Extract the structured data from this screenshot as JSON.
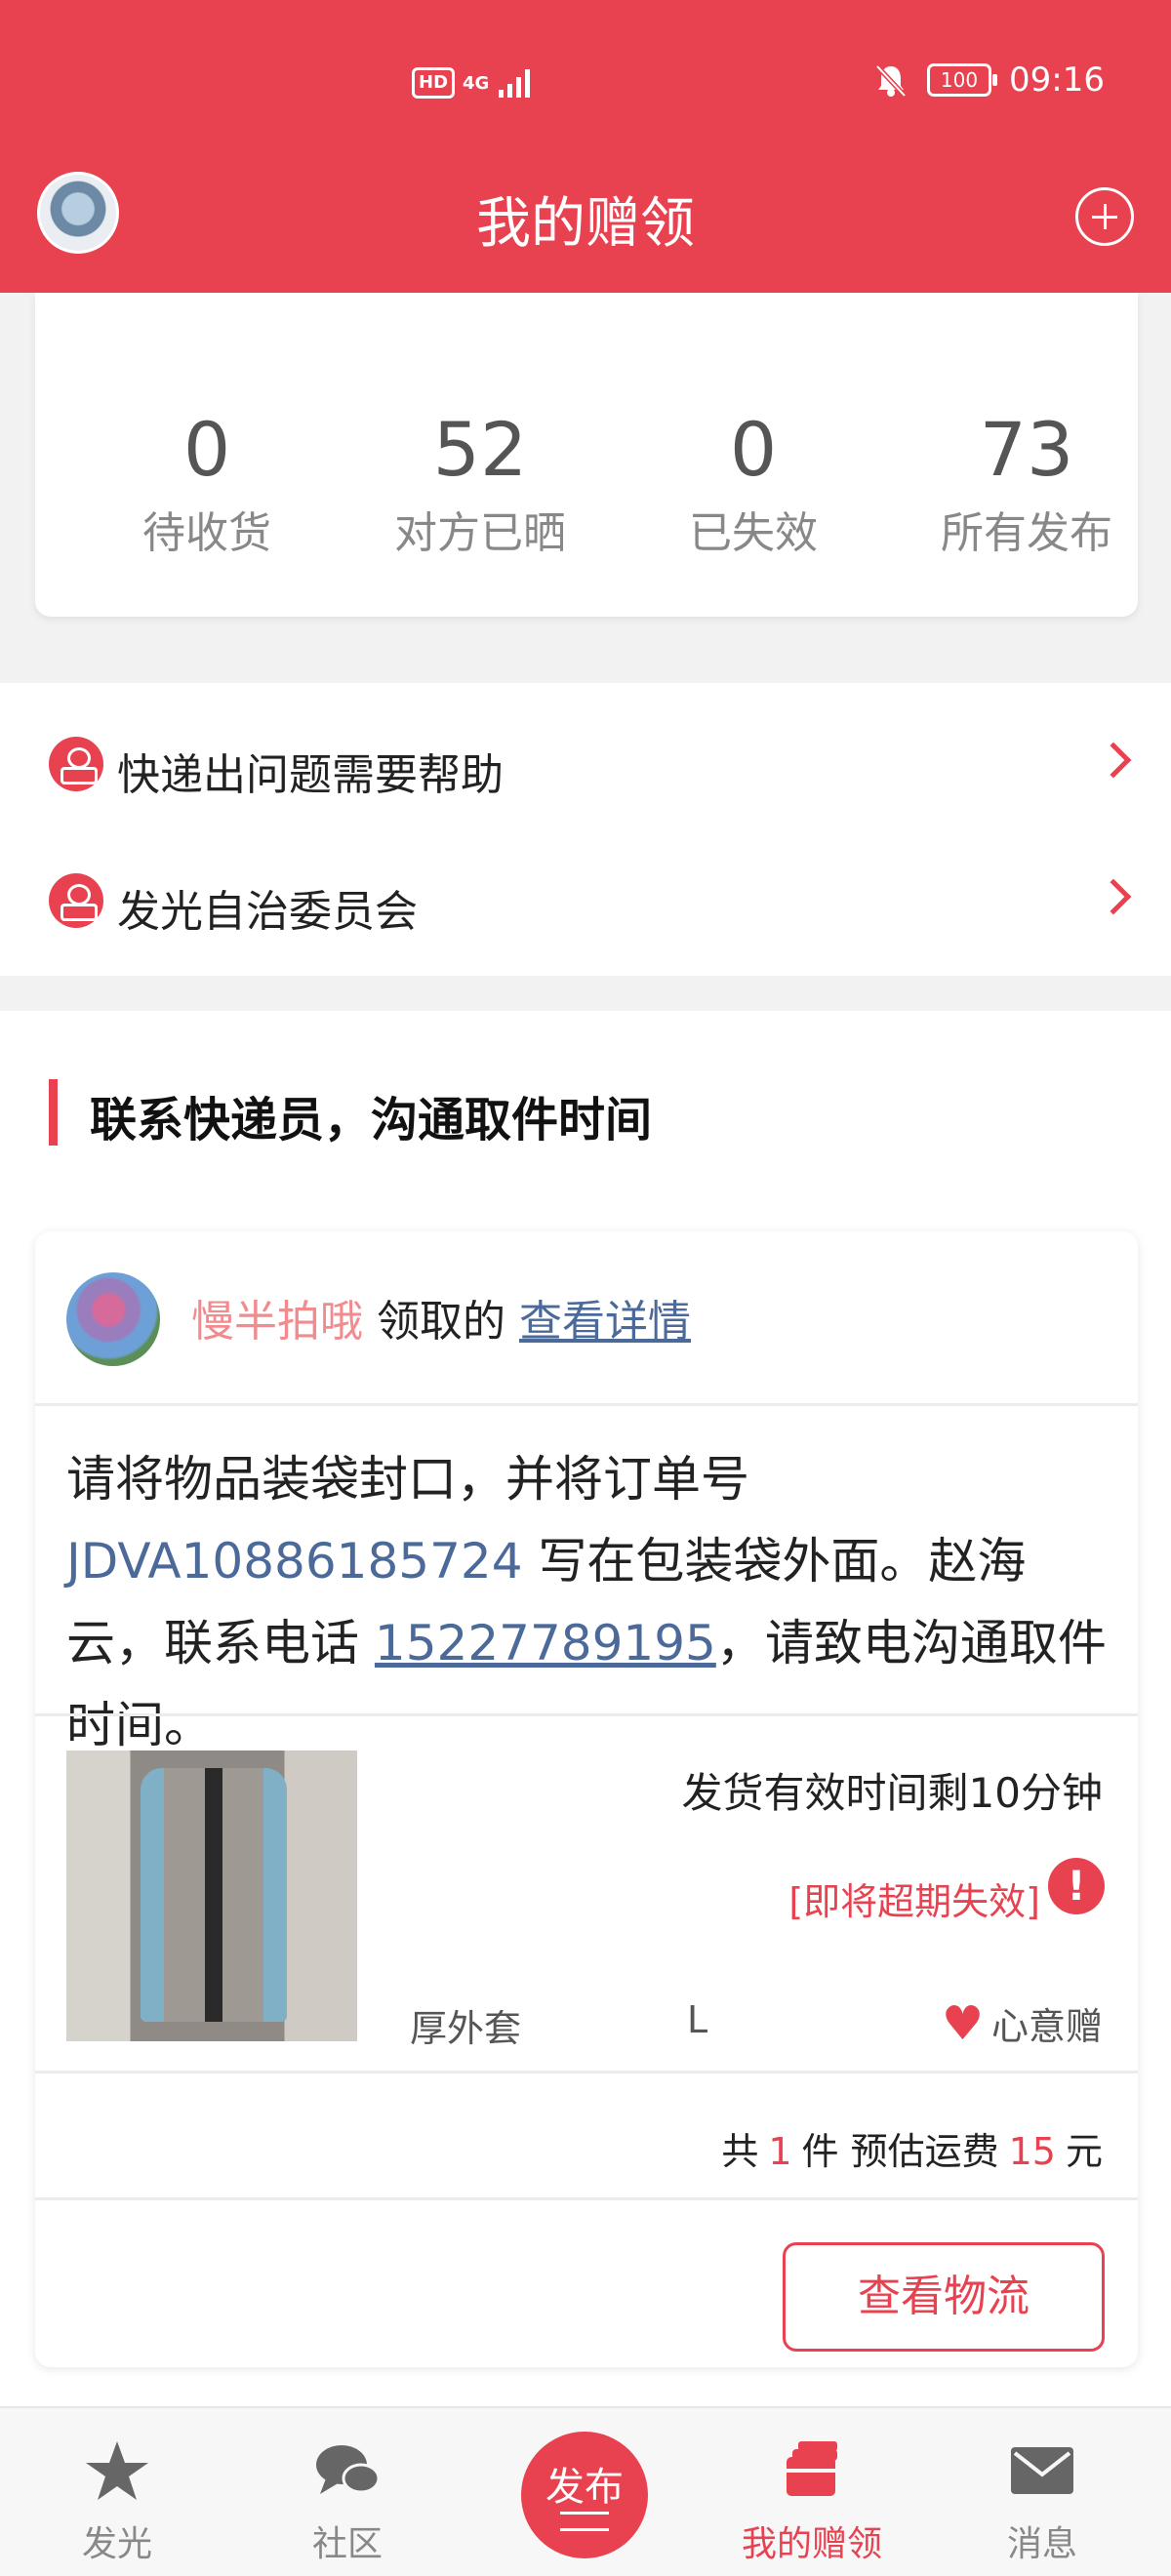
{
  "statusbar": {
    "network": "4G",
    "hd": "HD",
    "battery": "100",
    "time": "09:16"
  },
  "header": {
    "title": "我的赠领"
  },
  "stats": [
    {
      "value": "0",
      "label": "待收货"
    },
    {
      "value": "52",
      "label": "对方已晒"
    },
    {
      "value": "0",
      "label": "已失效"
    },
    {
      "value": "73",
      "label": "所有发布"
    }
  ],
  "help": [
    {
      "label": "快递出问题需要帮助"
    },
    {
      "label": "发光自治委员会"
    }
  ],
  "section": {
    "title": "联系快递员，沟通取件时间"
  },
  "order": {
    "user_name": "慢半拍哦",
    "action_text": "领取的",
    "detail_link": "查看详情",
    "instruction_part1": "请将物品装袋封口，并将订单号",
    "order_number": "JDVA10886185724",
    "instruction_part2": "写在包装袋外面。赵海云，联系电话",
    "phone": "15227789195",
    "instruction_part3": "，请致电沟通取件时间。",
    "deadline": "发货有效时间剩10分钟",
    "overdue": "[即将超期失效]",
    "alert_symbol": "!",
    "item_name": "厚外套",
    "item_size": "L",
    "gift_type": "心意赠",
    "summary_prefix": "共",
    "quantity": "1",
    "summary_mid": "件 预估运费",
    "shipping_fee": "15",
    "summary_suffix": "元",
    "logistics_button": "查看物流"
  },
  "bottom_nav": [
    {
      "label": "发光",
      "icon": "star-icon"
    },
    {
      "label": "社区",
      "icon": "chat-icon"
    },
    {
      "label": "发布",
      "icon": "publish-icon"
    },
    {
      "label": "我的赠领",
      "icon": "gift-box-icon",
      "active": true
    },
    {
      "label": "消息",
      "icon": "mail-icon"
    }
  ],
  "colors": {
    "brand": "#e84250",
    "link": "#4b6a9a",
    "username": "#f18b8e"
  }
}
